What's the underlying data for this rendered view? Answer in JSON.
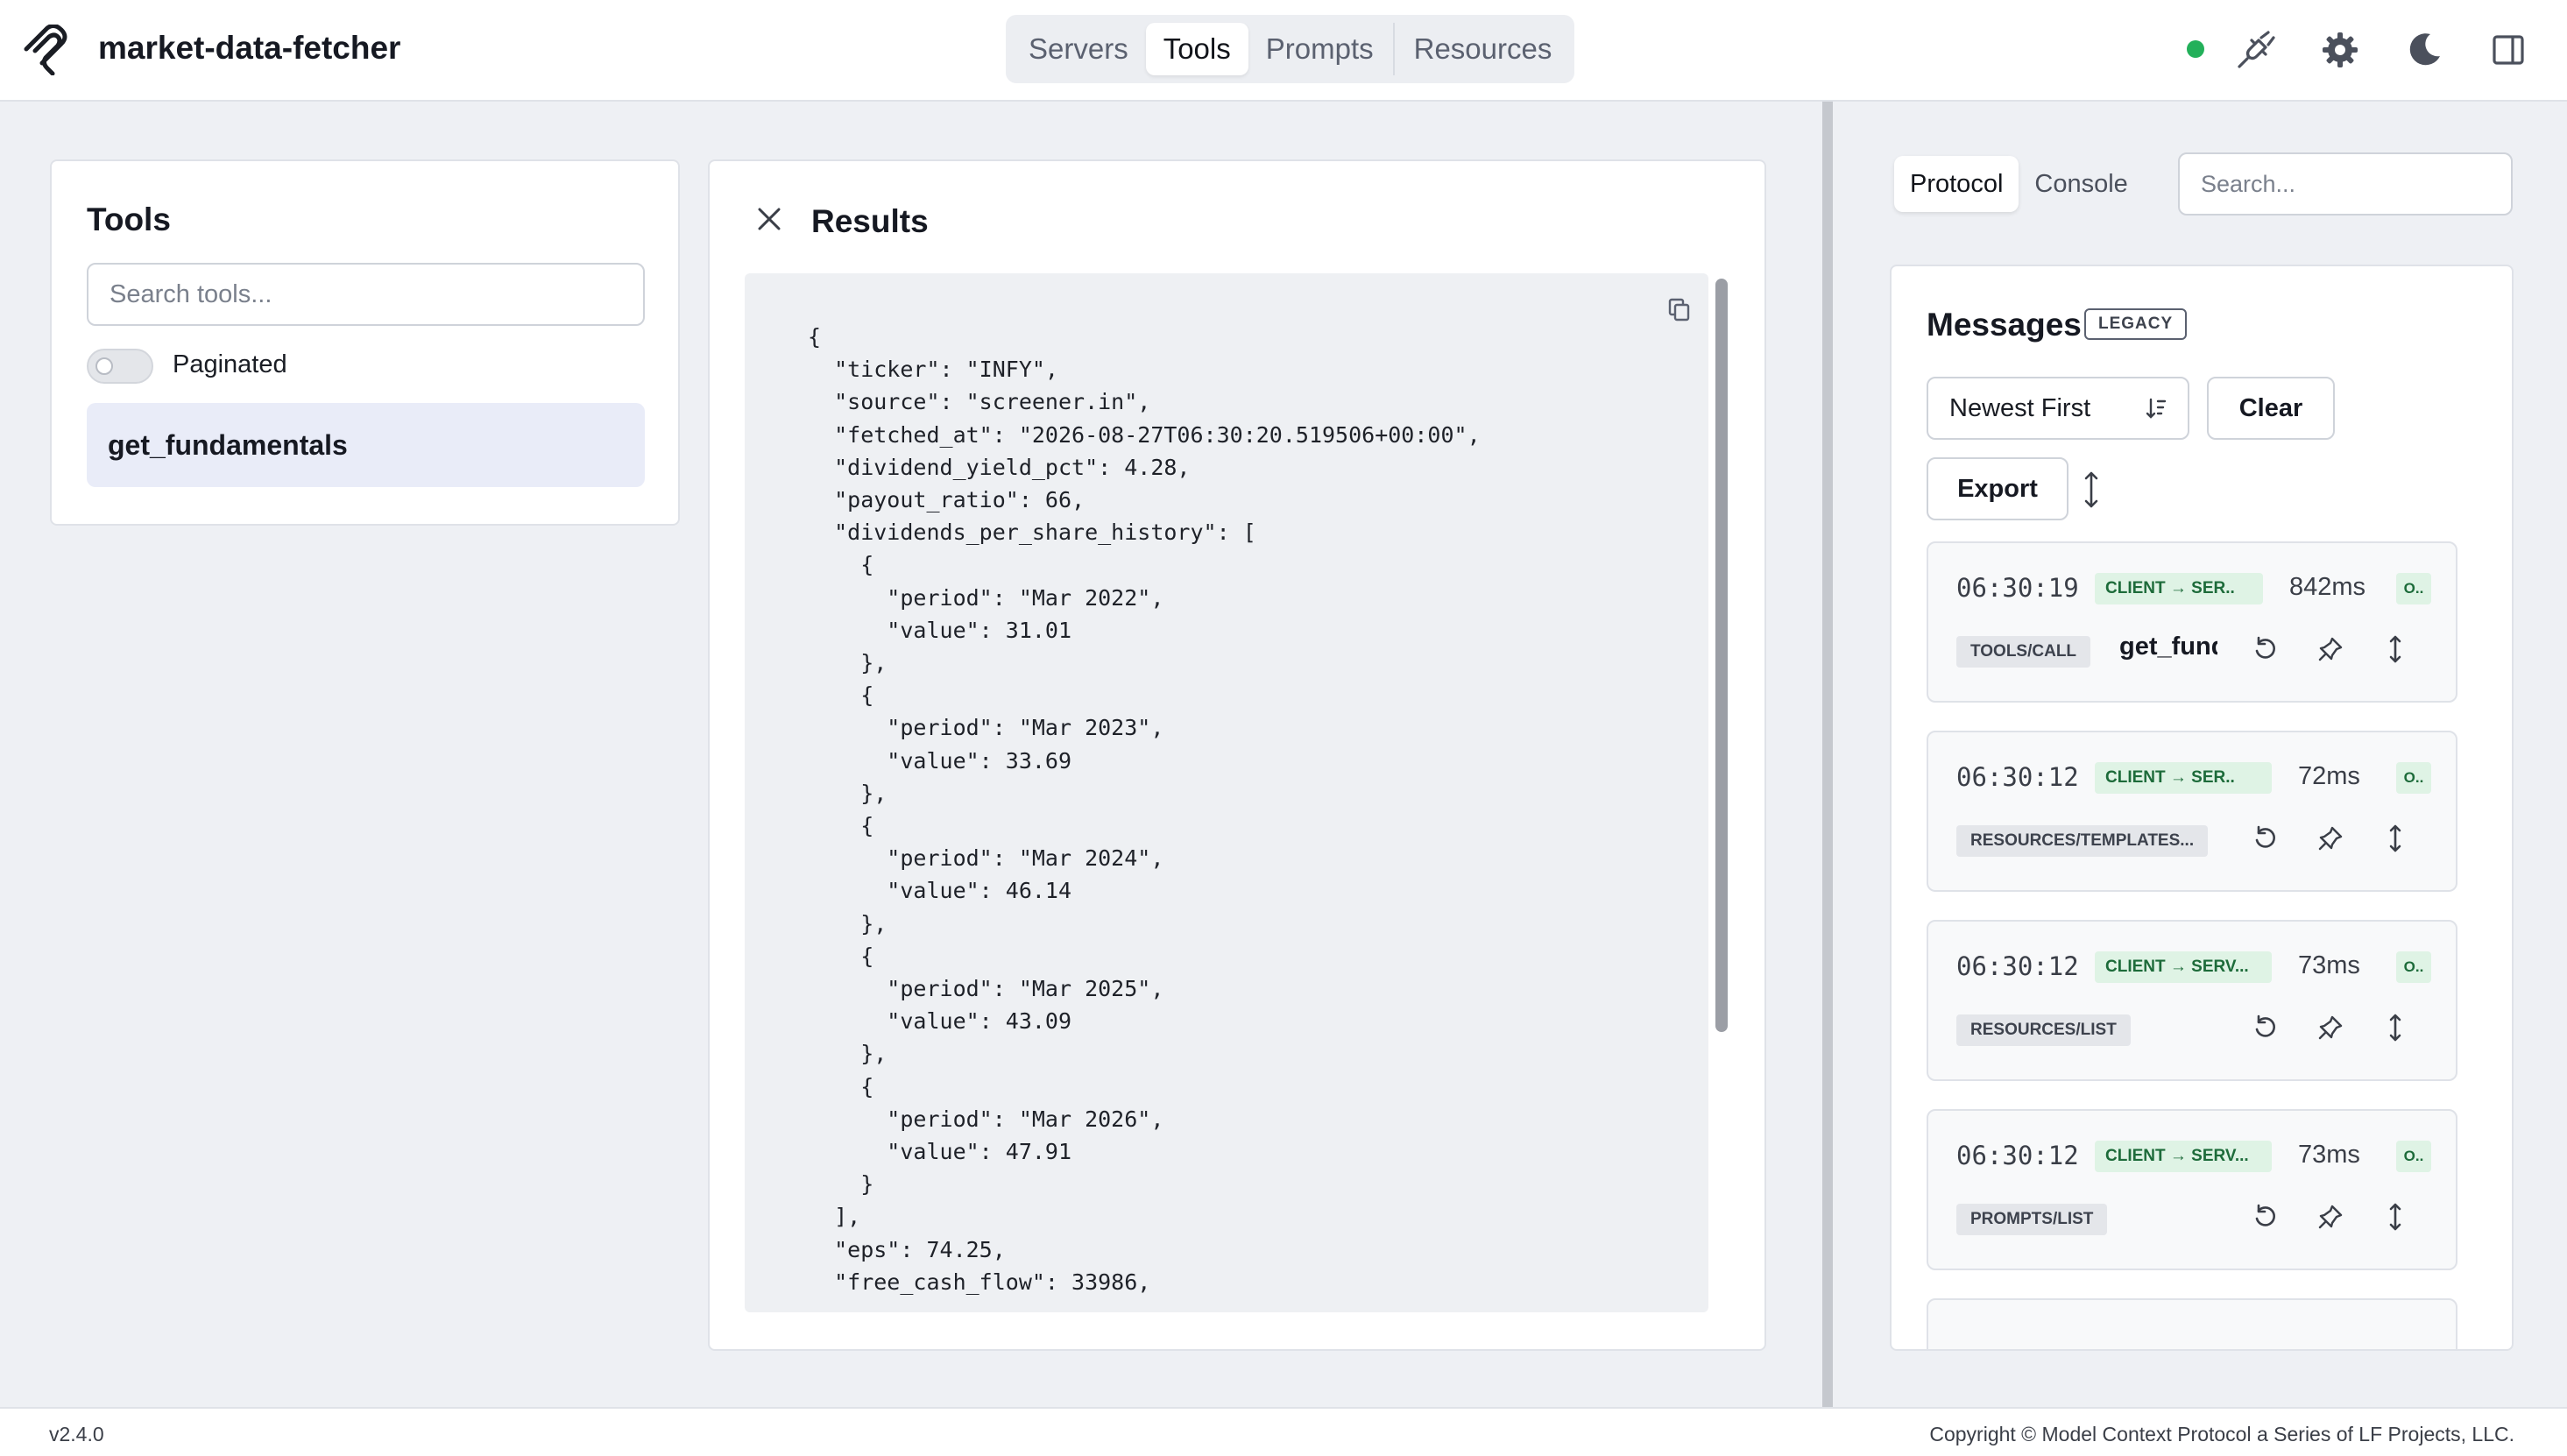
{
  "header": {
    "app_title": "market-data-fetcher",
    "tabs": [
      {
        "label": "Servers",
        "active": false
      },
      {
        "label": "Tools",
        "active": true
      },
      {
        "label": "Prompts",
        "active": false
      },
      {
        "label": "Resources",
        "active": false
      }
    ],
    "connection_status_color": "#23b05a",
    "icons": [
      "plug-icon",
      "gear-icon",
      "moon-icon",
      "sidebar-toggle-icon"
    ]
  },
  "tools_panel": {
    "title": "Tools",
    "search_placeholder": "Search tools...",
    "paginated_label": "Paginated",
    "paginated_enabled": false,
    "items": [
      {
        "name": "get_fundamentals",
        "selected": true
      }
    ]
  },
  "results_panel": {
    "title": "Results",
    "json_text": "{\n  \"ticker\": \"INFY\",\n  \"source\": \"screener.in\",\n  \"fetched_at\": \"2026-08-27T06:30:20.519506+00:00\",\n  \"dividend_yield_pct\": 4.28,\n  \"payout_ratio\": 66,\n  \"dividends_per_share_history\": [\n    {\n      \"period\": \"Mar 2022\",\n      \"value\": 31.01\n    },\n    {\n      \"period\": \"Mar 2023\",\n      \"value\": 33.69\n    },\n    {\n      \"period\": \"Mar 2024\",\n      \"value\": 46.14\n    },\n    {\n      \"period\": \"Mar 2025\",\n      \"value\": 43.09\n    },\n    {\n      \"period\": \"Mar 2026\",\n      \"value\": 47.91\n    }\n  ],\n  \"eps\": 74.25,\n  \"free_cash_flow\": 33986,"
  },
  "side_panel": {
    "tabs": [
      {
        "label": "Protocol",
        "active": true
      },
      {
        "label": "Console",
        "active": false
      }
    ],
    "search_placeholder": "Search...",
    "messages_title": "Messages",
    "legacy_badge": "LEGACY",
    "sort_value": "Newest First",
    "clear_label": "Clear",
    "export_label": "Export",
    "messages": [
      {
        "time": "06:30:19",
        "direction": "CLIENT → SER..",
        "duration": "842ms",
        "status": "O..",
        "method": "TOOLS/CALL",
        "tool": "get_fundamentals"
      },
      {
        "time": "06:30:12",
        "direction": "CLIENT → SER..",
        "duration": "72ms",
        "status": "O..",
        "method": "RESOURCES/TEMPLATES...",
        "tool": ""
      },
      {
        "time": "06:30:12",
        "direction": "CLIENT → SERV...",
        "duration": "73ms",
        "status": "O..",
        "method": "RESOURCES/LIST",
        "tool": ""
      },
      {
        "time": "06:30:12",
        "direction": "CLIENT → SERV...",
        "duration": "73ms",
        "status": "O..",
        "method": "PROMPTS/LIST",
        "tool": ""
      }
    ]
  },
  "footer": {
    "version": "v2.4.0",
    "copyright": "Copyright © Model Context Protocol a Series of LF Projects, LLC."
  }
}
